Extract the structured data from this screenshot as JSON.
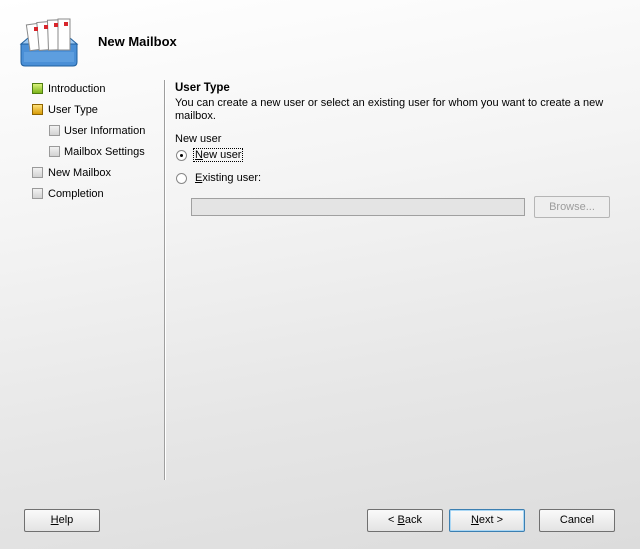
{
  "header": {
    "title": "New Mailbox",
    "icon": "mailbox-icon"
  },
  "steps": [
    {
      "label": "Introduction",
      "level": 0,
      "state": "done"
    },
    {
      "label": "User Type",
      "level": 0,
      "state": "current"
    },
    {
      "label": "User Information",
      "level": 1,
      "state": "pending"
    },
    {
      "label": "Mailbox Settings",
      "level": 1,
      "state": "pending"
    },
    {
      "label": "New Mailbox",
      "level": 0,
      "state": "pending"
    },
    {
      "label": "Completion",
      "level": 0,
      "state": "pending"
    }
  ],
  "content": {
    "title": "User Type",
    "description": "You can create a new user or select an existing user for whom you want to create a new mailbox.",
    "group_label": "New user",
    "options": {
      "new_user": {
        "access_key": "N",
        "rest": "ew user",
        "checked": true
      },
      "existing_user": {
        "access_key": "E",
        "rest": "xisting user:",
        "checked": false
      }
    },
    "existing_user_value": "",
    "browse_label": "Browse..."
  },
  "footer": {
    "help": {
      "key": "H",
      "rest": "elp"
    },
    "back": {
      "prefix": "< ",
      "key": "B",
      "rest": "ack"
    },
    "next": {
      "key": "N",
      "rest": "ext >"
    },
    "cancel": "Cancel"
  },
  "colors": {
    "done": "#7cb51a",
    "current": "#d79b08",
    "pending": "#d2d2d2",
    "accent": "#3c7fb1"
  }
}
